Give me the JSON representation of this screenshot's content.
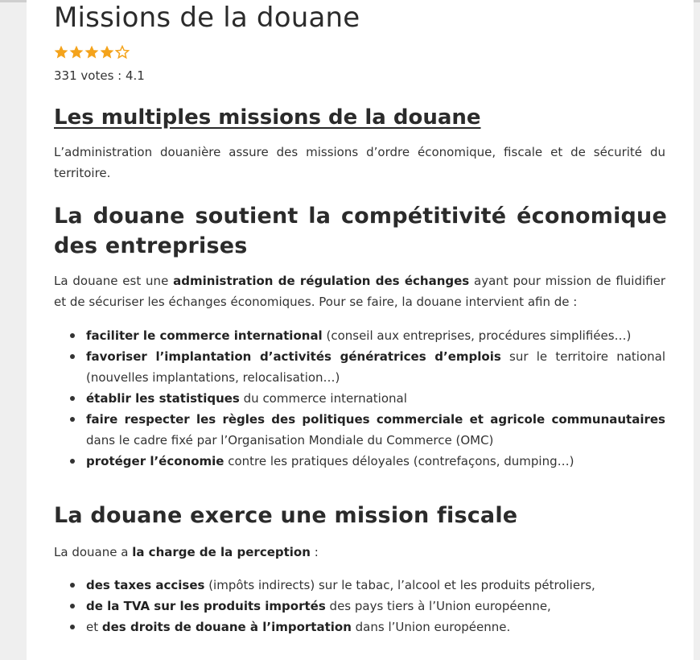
{
  "article": {
    "title": "Missions de la douane",
    "rating": {
      "value": 4.1,
      "max": 5,
      "votes_text": "331 votes : 4.1",
      "star_color": "#f4a31b"
    },
    "section1": {
      "heading": "Les multiples missions de la douane",
      "paragraph": "L’administration douanière assure des missions d’ordre économique, fiscale et de sécurité du territoire."
    },
    "section2": {
      "heading": "La douane soutient la compétitivité économique des entreprises",
      "intro_pre": "La douane est une ",
      "intro_bold": "administration de régulation des échanges",
      "intro_post": " ayant pour mission de fluidifier et de sécuriser les échanges économiques. Pour se faire, la douane intervient afin de :",
      "items": [
        {
          "pre": "",
          "bold": "faciliter le commerce international",
          "post": " (conseil aux entreprises, procédures simplifiées…)"
        },
        {
          "pre": "",
          "bold": "favoriser l’implantation d’activités génératrices d’emplois",
          "post": " sur le territoire national (nouvelles implantations, relocalisation…)"
        },
        {
          "pre": "",
          "bold": "établir les statistiques",
          "post": " du commerce international"
        },
        {
          "pre": "",
          "bold": "faire respecter les règles des politiques commerciale et agricole communautaires",
          "post": " dans le cadre fixé par l’Organisation Mondiale du Commerce (OMC)"
        },
        {
          "pre": "",
          "bold": "protéger l’économie",
          "post": " contre les pratiques déloyales (contrefaçons, dumping…)"
        }
      ]
    },
    "section3": {
      "heading": "La douane exerce une mission fiscale",
      "intro_pre": "La douane a ",
      "intro_bold": "la charge de la perception",
      "intro_post": " :",
      "items": [
        {
          "pre": "",
          "bold": "des taxes accises",
          "post": " (impôts indirects) sur le tabac, l’alcool et les produits pétroliers,"
        },
        {
          "pre": "",
          "bold": "de la TVA sur les produits importés",
          "post": " des pays tiers à l’Union européenne,"
        },
        {
          "pre": "et ",
          "bold": "des droits de douane à l’importation",
          "post": " dans l’Union européenne."
        }
      ]
    }
  }
}
